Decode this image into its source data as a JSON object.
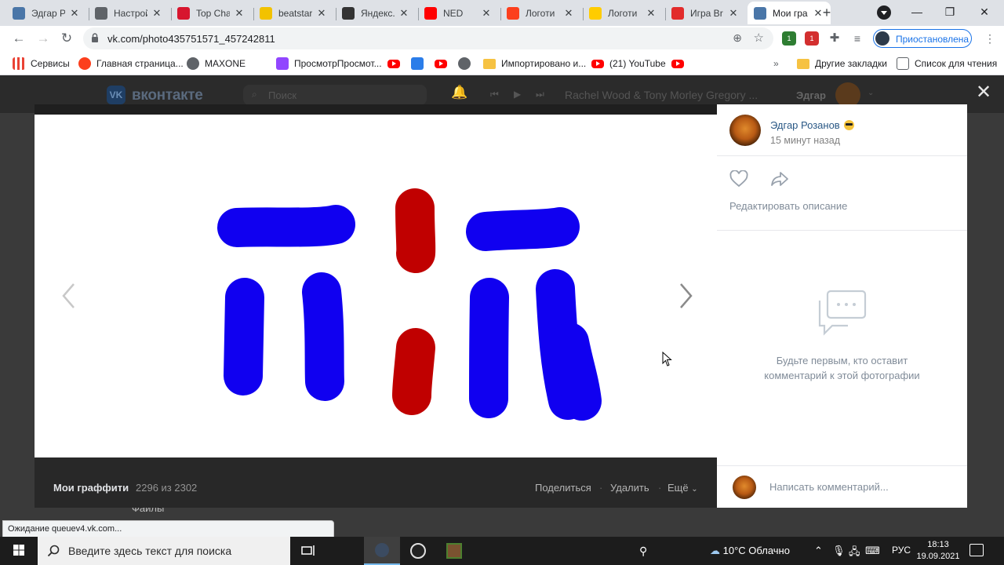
{
  "browser": {
    "tabs": [
      {
        "title": "Эдгар Ро",
        "favicon": "vk-icon",
        "color": "#4a76a8",
        "active": false
      },
      {
        "title": "Настрой",
        "favicon": "gear-icon",
        "color": "#5f6368",
        "active": false
      },
      {
        "title": "Top Char",
        "favicon": "topchart-icon",
        "color": "#d7152e",
        "active": false
      },
      {
        "title": "beatstar",
        "favicon": "play-icon",
        "color": "#f2c200",
        "active": false
      },
      {
        "title": "Яндекс.К",
        "favicon": "yandex-kassa-icon",
        "color": "#333333",
        "active": false
      },
      {
        "title": "NED",
        "favicon": "youtube-icon",
        "color": "#ff0000",
        "active": false
      },
      {
        "title": "Логоти",
        "favicon": "yandex-icon",
        "color": "#fc3f1d",
        "active": false
      },
      {
        "title": "Логоти",
        "favicon": "yandex-images-icon",
        "color": "#ffcc00",
        "active": false
      },
      {
        "title": "Игра Br",
        "favicon": "game-icon",
        "color": "#e22b2b",
        "active": false
      },
      {
        "title": "Мои гра",
        "favicon": "vk-icon",
        "color": "#4a76a8",
        "active": true
      }
    ],
    "url": "vk.com/photo435751571_457242811",
    "profile_status": "Приостановлена",
    "bookmarks": [
      {
        "label": "Сервисы",
        "icon": "apps-grid-icon"
      },
      {
        "label": "Главная страница...",
        "icon": "yandex-icon"
      },
      {
        "label": "MAXONE",
        "icon": "globe-icon"
      },
      {
        "label": "ПросмотрПросмот...",
        "icon": "twitch-icon"
      },
      {
        "label": "",
        "icon": "youtube-icon"
      },
      {
        "label": "",
        "icon": "pause-icon"
      },
      {
        "label": "",
        "icon": "youtube-icon"
      },
      {
        "label": "",
        "icon": "globe-icon"
      },
      {
        "label": "Импортировано и...",
        "icon": "folder-icon"
      },
      {
        "label": "(21) YouTube",
        "icon": "youtube-icon"
      },
      {
        "label": "",
        "icon": "youtube-icon"
      }
    ],
    "other_bookmarks": "Другие закладки",
    "reading_list": "Список для чтения",
    "overflow": "»",
    "ext_badge_count": "1",
    "status_text": "Ожидание queuev4.vk.com..."
  },
  "vk": {
    "logo_text": "вконтакте",
    "search_placeholder": "Поиск",
    "now_playing": "Rachel Wood & Tony Morley Gregory ...",
    "user_short": "Эдгар",
    "files_label": "Файлы",
    "viewer": {
      "album": "Мои граффити",
      "counter": "2296 из 2302",
      "share": "Поделиться",
      "delete": "Удалить",
      "more": "Ещё",
      "separator": "·"
    },
    "side": {
      "owner_name": "Эдгар Розанов",
      "time": "15 минут назад",
      "edit_description": "Редактировать описание",
      "empty_line1": "Будьте первым, кто оставит",
      "empty_line2": "комментарий к этой фотографии",
      "comment_placeholder": "Написать комментарий..."
    },
    "graffiti_colors": {
      "blue": "#1000f0",
      "red": "#c00000"
    }
  },
  "taskbar": {
    "search_placeholder": "Введите здесь текст для поиска",
    "weather": "10°C  Облачно",
    "lang": "РУС",
    "time": "18:13",
    "date": "19.09.2021"
  }
}
